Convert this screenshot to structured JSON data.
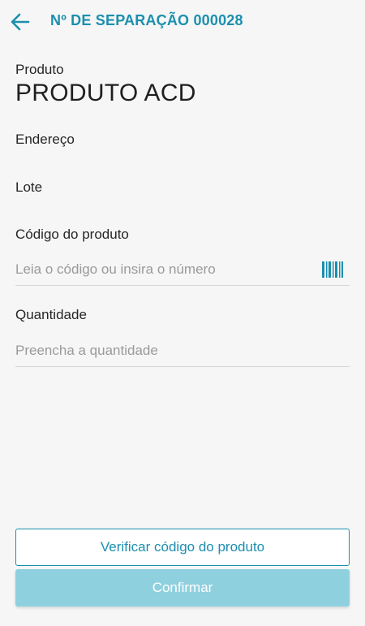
{
  "header": {
    "title": "Nº DE SEPARAÇÃO 000028",
    "back_icon": "arrow-left-icon"
  },
  "product": {
    "label": "Produto",
    "name": "PRODUTO ACD"
  },
  "fields": {
    "endereco_label": "Endereço",
    "lote_label": "Lote",
    "codigo_label": "Código do produto",
    "codigo_placeholder": "Leia o código ou insira o número",
    "codigo_value": "",
    "barcode_icon": "barcode-icon",
    "quantidade_label": "Quantidade",
    "quantidade_placeholder": "Preencha a quantidade",
    "quantidade_value": ""
  },
  "actions": {
    "verify_label": "Verificar código do produto",
    "confirm_label": "Confirmar"
  },
  "colors": {
    "accent": "#1b8fae",
    "confirm_disabled": "#8fd0df",
    "background": "#f5f6f5"
  }
}
